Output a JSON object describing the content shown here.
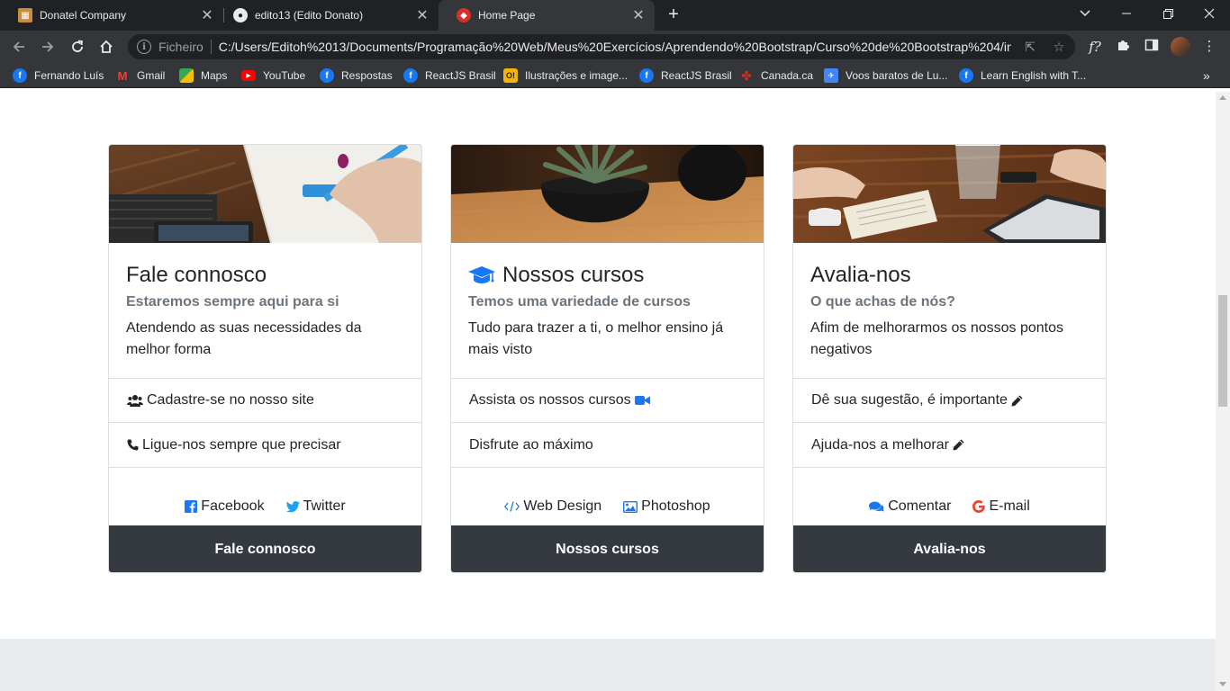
{
  "browser": {
    "tabs": [
      {
        "title": "Donatel Company"
      },
      {
        "title": "edito13 (Edito Donato)"
      },
      {
        "title": "Home Page"
      }
    ],
    "omnibox": {
      "scheme_label": "Ficheiro",
      "url": "C:/Users/Editoh%2013/Documents/Programação%20Web/Meus%20Exercícios/Aprendendo%20Bootstrap/Curso%20de%20Bootstrap%204/in..."
    },
    "bookmarks": [
      {
        "label": "Fernando Luís",
        "icon": "facebook-icon",
        "color": "#1877f2"
      },
      {
        "label": "Gmail",
        "icon": "gmail-icon",
        "color": "#ea4335"
      },
      {
        "label": "Maps",
        "icon": "maps-icon",
        "color": "#34a853"
      },
      {
        "label": "YouTube",
        "icon": "youtube-icon",
        "color": "#ff0000"
      },
      {
        "label": "Respostas",
        "icon": "facebook-icon",
        "color": "#1877f2"
      },
      {
        "label": "ReactJS Brasil",
        "icon": "facebook-icon",
        "color": "#1877f2"
      },
      {
        "label": "Ilustrações e image...",
        "icon": "illustration-icon",
        "color": "#f4b400"
      },
      {
        "label": "ReactJS Brasil",
        "icon": "facebook-icon",
        "color": "#1877f2"
      },
      {
        "label": "Canada.ca",
        "icon": "maple-leaf-icon",
        "color": "#d52b1e"
      },
      {
        "label": "Voos baratos de Lu...",
        "icon": "flights-icon",
        "color": "#4285f4"
      },
      {
        "label": "Learn English with T...",
        "icon": "facebook-icon",
        "color": "#1877f2"
      }
    ]
  },
  "cards": [
    {
      "title": "Fale connosco",
      "subtitle": "Estaremos sempre aqui para si",
      "text": "Atendendo as suas necessidades da melhor forma",
      "items": [
        "Cadastre-se no nosso site",
        "Ligue-nos sempre que precisar"
      ],
      "links": [
        "Facebook",
        "Twitter"
      ],
      "footer": "Fale connosco"
    },
    {
      "title": "Nossos cursos",
      "subtitle": "Temos uma variedade de cursos",
      "text": "Tudo para trazer a ti, o melhor ensino já mais visto",
      "items": [
        "Assista os nossos cursos",
        "Disfrute ao máximo"
      ],
      "links": [
        "Web Design",
        "Photoshop"
      ],
      "footer": "Nossos cursos"
    },
    {
      "title": "Avalia-nos",
      "subtitle": "O que achas de nós?",
      "text": "Afim de melhorarmos os nossos pontos negativos",
      "items": [
        "Dê sua sugestão, é importante",
        "Ajuda-nos a melhorar"
      ],
      "links": [
        "Comentar",
        "E-mail"
      ],
      "footer": "Avalia-nos"
    }
  ],
  "colors": {
    "accent_blue": "#1877f2",
    "google_red": "#ea4335",
    "footer_dark": "#343a40",
    "muted": "#6c757d"
  }
}
